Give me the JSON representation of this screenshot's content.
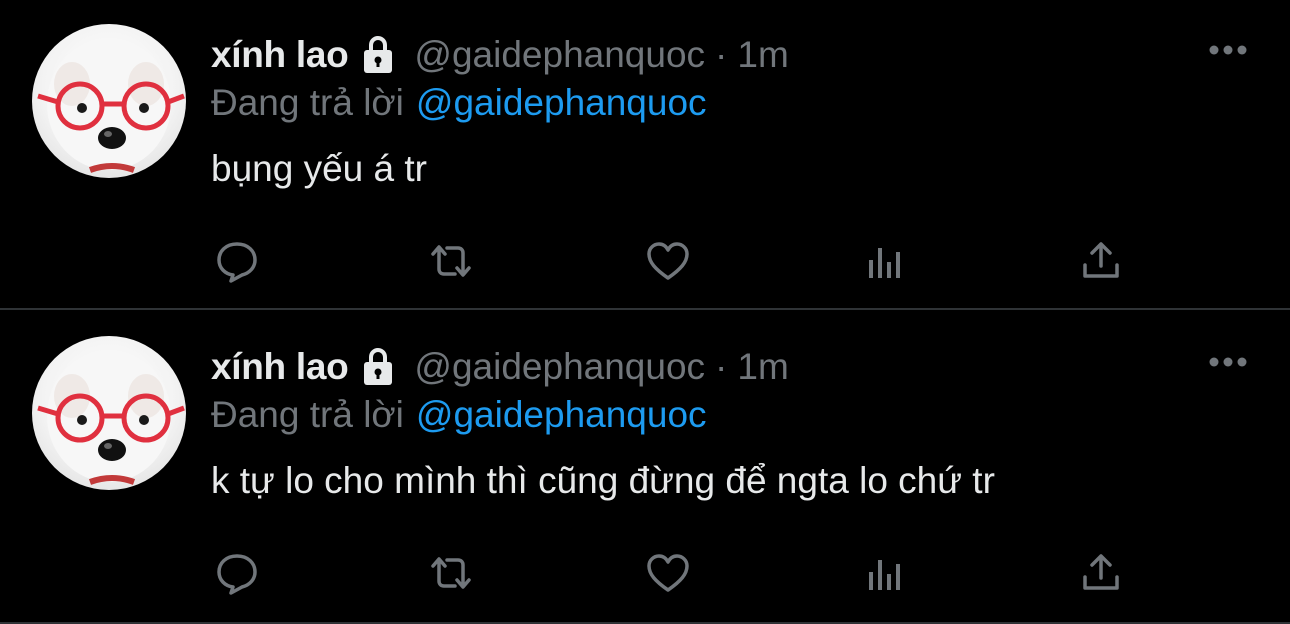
{
  "colors": {
    "background": "#000000",
    "divider": "#2f3336",
    "primary_text": "#e7e9ea",
    "secondary_text": "#71767b",
    "accent": "#1d9bf0"
  },
  "tweets": [
    {
      "display_name": "xính lao",
      "handle": "@gaidephanquoc",
      "separator": "·",
      "time": "1m",
      "reply_prefix": "Đang trả lời",
      "reply_target": "@gaidephanquoc",
      "text": "bụng yếu á tr",
      "icons": [
        "lock-icon",
        "more-icon",
        "reply-icon",
        "retweet-icon",
        "like-icon",
        "views-icon",
        "share-icon"
      ]
    },
    {
      "display_name": "xính lao",
      "handle": "@gaidephanquoc",
      "separator": "·",
      "time": "1m",
      "reply_prefix": "Đang trả lời",
      "reply_target": "@gaidephanquoc",
      "text": "k tự lo cho mình thì cũng đừng để ngta lo chứ tr",
      "icons": [
        "lock-icon",
        "more-icon",
        "reply-icon",
        "retweet-icon",
        "like-icon",
        "views-icon",
        "share-icon"
      ]
    }
  ]
}
